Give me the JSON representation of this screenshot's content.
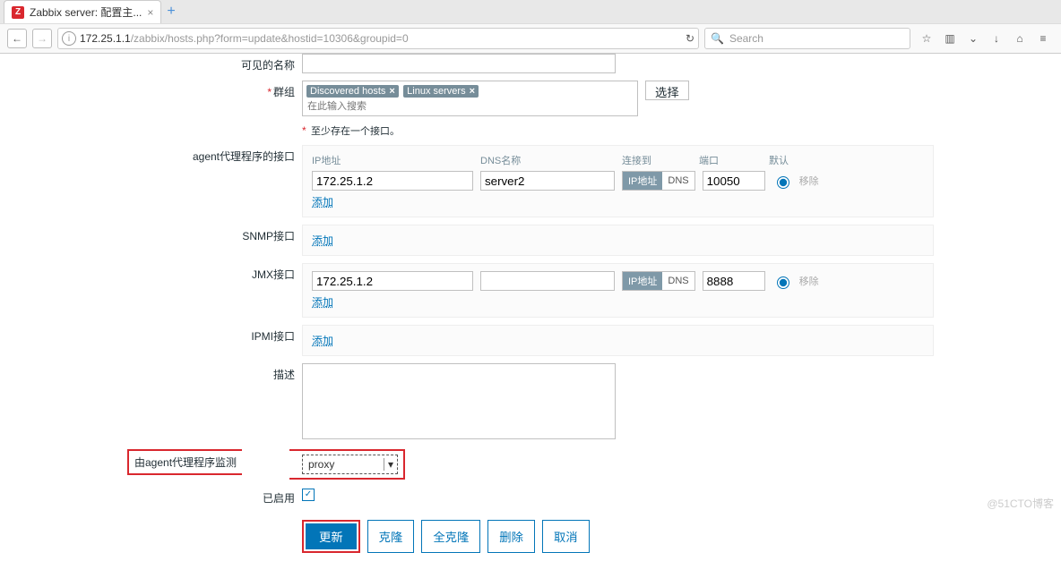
{
  "browser": {
    "tab_title": "Zabbix server: 配置主...",
    "url_host": "172.25.1.1",
    "url_path": "/zabbix/hosts.php?form=update&hostid=10306&groupid=0",
    "search_placeholder": "Search"
  },
  "form": {
    "visible_name_label": "可见的名称",
    "visible_name_value": "",
    "groups_label": "群组",
    "group_tags": [
      {
        "name": "Discovered hosts"
      },
      {
        "name": "Linux servers"
      }
    ],
    "group_search_placeholder": "在此输入搜索",
    "select_button": "选择",
    "at_least_one_interface": "至少存在一个接口。",
    "agent_iface_label": "agent代理程序的接口",
    "snmp_iface_label": "SNMP接口",
    "jmx_iface_label": "JMX接口",
    "ipmi_iface_label": "IPMI接口",
    "headers": {
      "ip": "IP地址",
      "dns": "DNS名称",
      "connect": "连接到",
      "port": "端口",
      "default": "默认"
    },
    "connect_ip": "IP地址",
    "connect_dns": "DNS",
    "remove_label": "移除",
    "add_label": "添加",
    "agent_rows": [
      {
        "ip": "172.25.1.2",
        "dns": "server2",
        "port": "10050",
        "default": true
      }
    ],
    "jmx_rows": [
      {
        "ip": "172.25.1.2",
        "dns": "",
        "port": "8888",
        "default": true
      }
    ],
    "description_label": "描述",
    "description_value": "",
    "proxy_label": "由agent代理程序监测",
    "proxy_value": "proxy",
    "enabled_label": "已启用",
    "enabled_checked": true,
    "buttons": {
      "update": "更新",
      "clone": "克隆",
      "full_clone": "全克隆",
      "delete": "删除",
      "cancel": "取消"
    }
  },
  "watermark": "@51CTO博客"
}
